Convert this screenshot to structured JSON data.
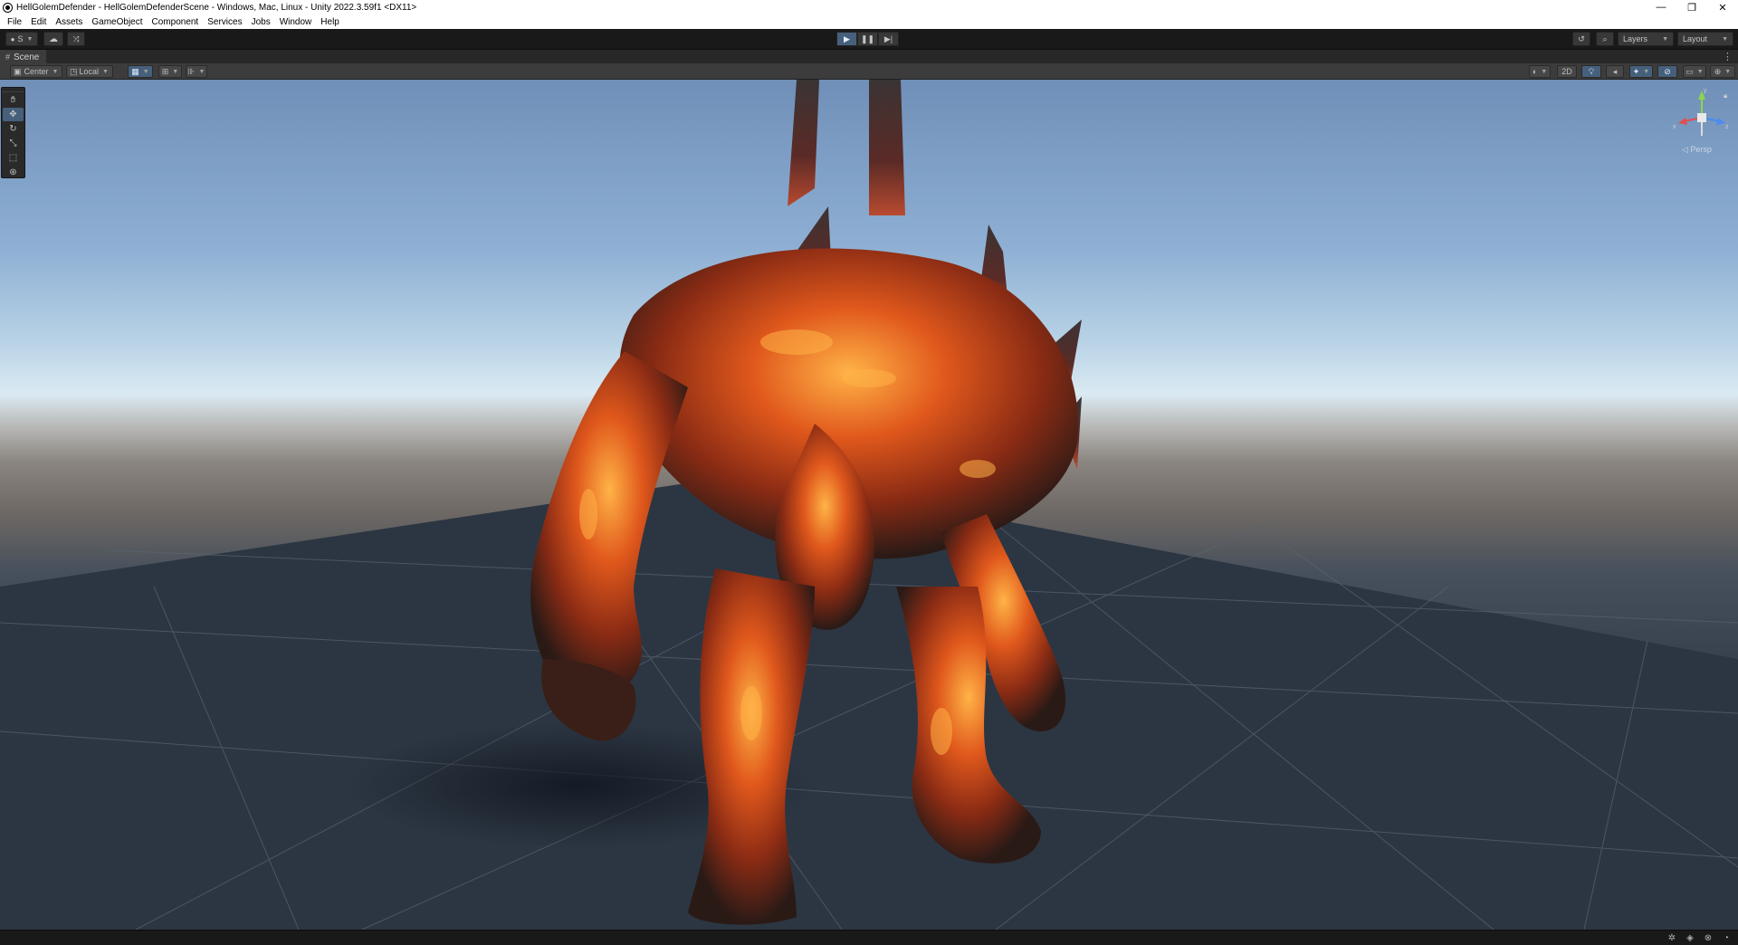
{
  "window": {
    "title": "HellGolemDefender - HellGolemDefenderScene - Windows, Mac, Linux - Unity 2022.3.59f1 <DX11>",
    "minimize_glyph": "—",
    "restore_glyph": "❐",
    "close_glyph": "✕"
  },
  "menu": {
    "items": [
      "File",
      "Edit",
      "Assets",
      "GameObject",
      "Component",
      "Services",
      "Jobs",
      "Window",
      "Help"
    ]
  },
  "toolbar": {
    "account_label": "S",
    "layers_label": "Layers",
    "layout_label": "Layout",
    "play_mode": "playing"
  },
  "scene_tab": {
    "label": "Scene"
  },
  "scene_toolbar": {
    "pivot_label": "Center",
    "space_label": "Local",
    "mode_2d_label": "2D"
  },
  "viewport": {
    "projection_label": "◁ Persp",
    "gizmo_axes": {
      "x": "x",
      "y": "y",
      "z": "z"
    },
    "colors": {
      "sky_top": "#6f8fb8",
      "horizon": "#dbeaf2",
      "ground_far": "#6e6864",
      "ground_near": "#26303c",
      "creature_base": "#2a1a16",
      "creature_lava": "#e0581c",
      "creature_glow": "#ffb347"
    }
  },
  "icons": {
    "hand": "hand-icon",
    "move": "move-icon",
    "rotate": "rotate-icon",
    "scale": "scale-icon",
    "rect": "rect-icon",
    "transform": "transform-icon"
  }
}
